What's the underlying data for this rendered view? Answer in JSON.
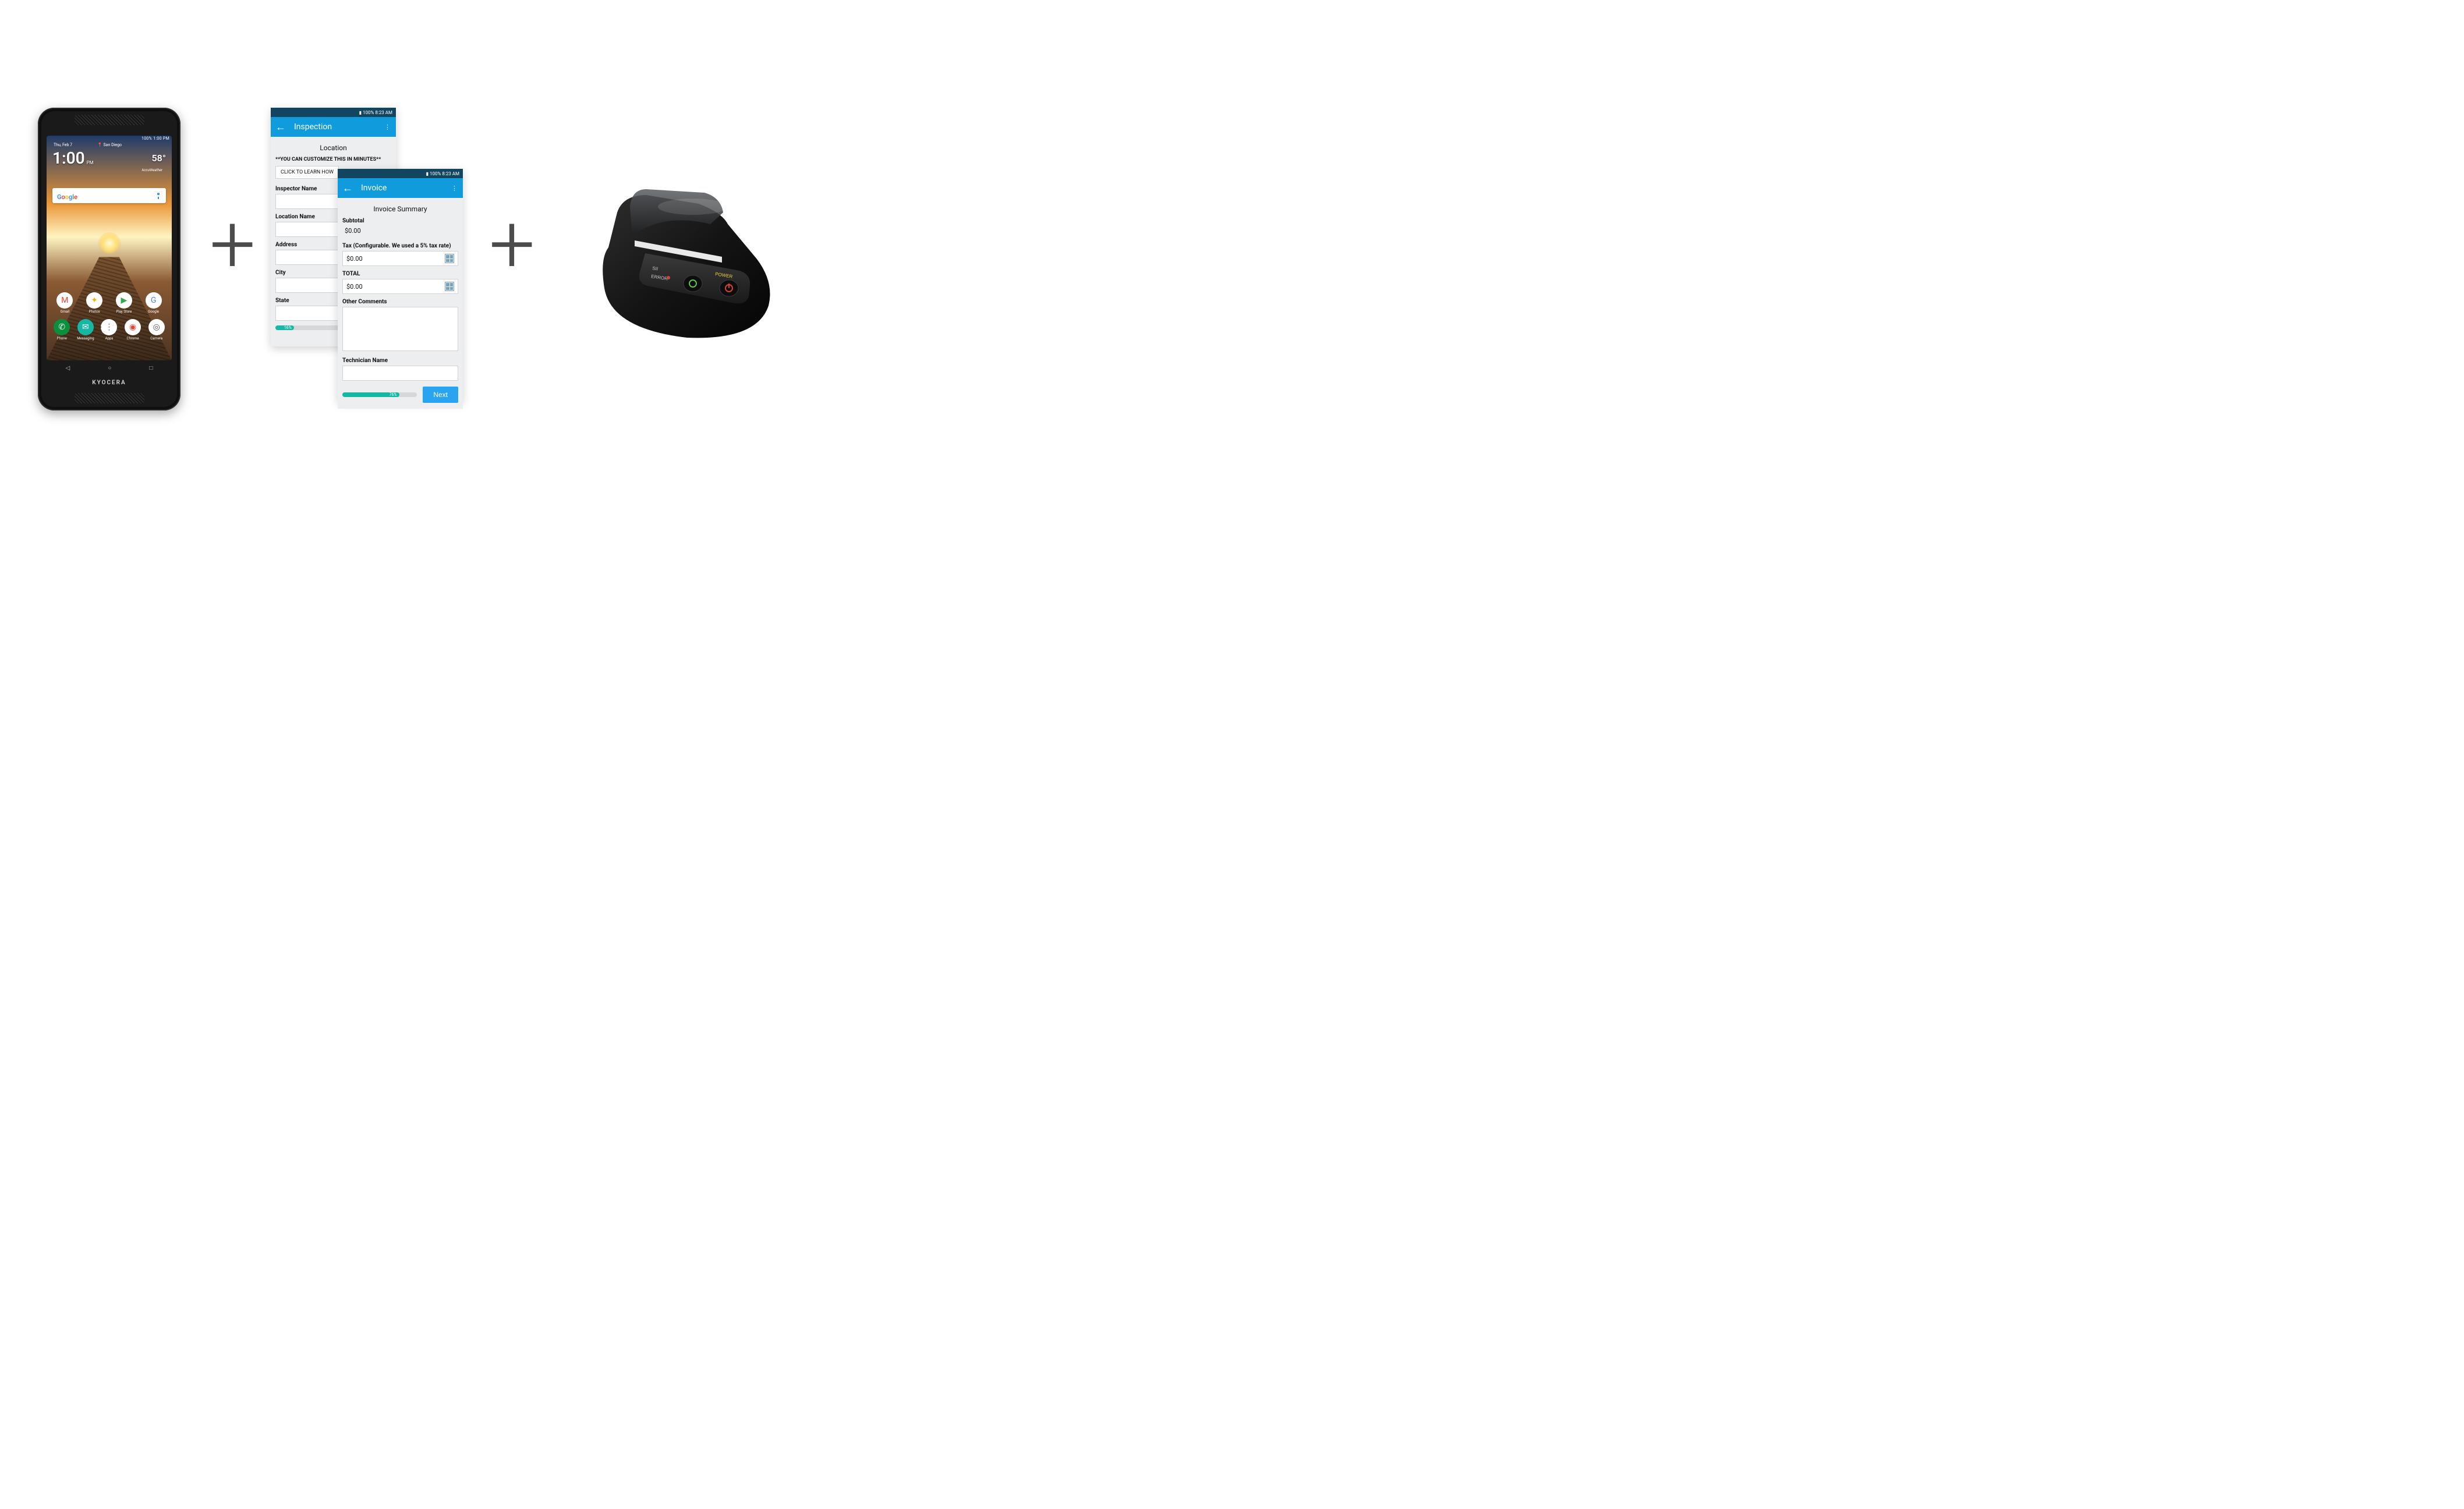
{
  "plus_symbol": "+",
  "phone": {
    "brand": "KYOCERA",
    "status_text": "100%  1:00 PM",
    "date": "Thu, Feb 7",
    "time": "1:00",
    "time_suffix": "PM",
    "location": "San Diego",
    "temperature": "58°",
    "weather_source": "AccuWeather",
    "search_logo_letters": [
      "G",
      "o",
      "o",
      "g",
      "l",
      "e"
    ],
    "apps_row1": [
      {
        "label": "Gmail",
        "icon": "M",
        "bg": "#ffffff",
        "fg": "#ea4335"
      },
      {
        "label": "Photos",
        "icon": "✦",
        "bg": "#ffffff",
        "fg": "#f4b400"
      },
      {
        "label": "Play Store",
        "icon": "▶",
        "bg": "#ffffff",
        "fg": "#34a853"
      },
      {
        "label": "Google",
        "icon": "G",
        "bg": "#ffffff",
        "fg": "#4285F4"
      }
    ],
    "apps_row2": [
      {
        "label": "Phone",
        "icon": "✆",
        "bg": "#0b8f3c",
        "fg": "#ffffff"
      },
      {
        "label": "Messaging",
        "icon": "✉",
        "bg": "#17b7a6",
        "fg": "#ffffff"
      },
      {
        "label": "Apps",
        "icon": "⋮⋮⋮",
        "bg": "#ffffff",
        "fg": "#555555"
      },
      {
        "label": "Chrome",
        "icon": "◉",
        "bg": "#ffffff",
        "fg": "#ea4335"
      },
      {
        "label": "Camera",
        "icon": "◎",
        "bg": "#ffffff",
        "fg": "#555555"
      }
    ],
    "navkeys": [
      "◁",
      "○",
      "□"
    ]
  },
  "shot1": {
    "status": "100%  8:23 AM",
    "title": "Inspection",
    "section": "Location",
    "note": "**YOU CAN CUSTOMIZE THIS IN MINUTES**",
    "learn_button": "CLICK TO LEARN HOW",
    "fields": [
      "Inspector Name",
      "Location Name",
      "Address",
      "City",
      "State"
    ],
    "progress_pct": 16,
    "progress_label": "16%"
  },
  "shot2": {
    "status": "100%  8:23 AM",
    "title": "Invoice",
    "section": "Invoice Summary",
    "subtotal_label": "Subtotal",
    "subtotal_value": "$0.00",
    "tax_label": "Tax (Configurable. We used a 5% tax rate)",
    "tax_value": "$0.00",
    "total_label": "TOTAL",
    "total_value": "$0.00",
    "comments_label": "Other Comments",
    "tech_label": "Technician Name",
    "progress_pct": 76,
    "progress_label": "76%",
    "next": "Next"
  },
  "printer": {
    "brand": "SII",
    "error_label": "ERROR",
    "power_label": "POWER"
  }
}
